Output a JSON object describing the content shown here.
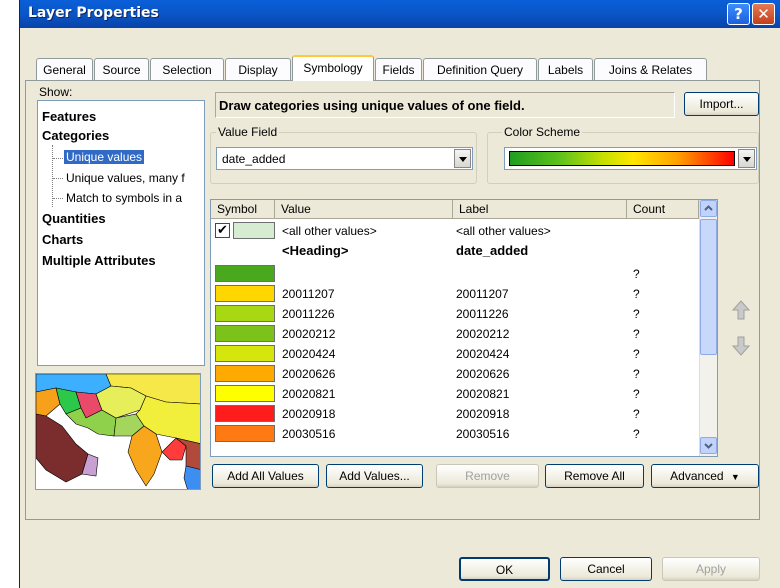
{
  "window": {
    "title": "Layer Properties",
    "help_button": "?",
    "close_button": "✕"
  },
  "tabs": [
    {
      "label": "General"
    },
    {
      "label": "Source"
    },
    {
      "label": "Selection"
    },
    {
      "label": "Display"
    },
    {
      "label": "Symbology",
      "active": true
    },
    {
      "label": "Fields"
    },
    {
      "label": "Definition Query"
    },
    {
      "label": "Labels"
    },
    {
      "label": "Joins & Relates"
    }
  ],
  "show": {
    "label": "Show:",
    "items": [
      {
        "label": "Features"
      },
      {
        "label": "Categories"
      },
      {
        "label": "Unique values",
        "selected": true
      },
      {
        "label": "Unique values, many f"
      },
      {
        "label": "Match to symbols in a"
      },
      {
        "label": "Quantities"
      },
      {
        "label": "Charts"
      },
      {
        "label": "Multiple Attributes"
      }
    ]
  },
  "description": "Draw categories using unique values of one field.",
  "import_button": "Import...",
  "value_field": {
    "label": "Value Field",
    "value": "date_added"
  },
  "color_scheme": {
    "label": "Color Scheme"
  },
  "table": {
    "headers": [
      "Symbol",
      "Value",
      "Label",
      "Count"
    ],
    "rows": [
      {
        "color": "#d6ecd1",
        "value": "<all other values>",
        "label": "<all other values>",
        "count": "",
        "checkbox": true
      },
      {
        "color": "",
        "value": "<Heading>",
        "label": "date_added",
        "count": "",
        "heading": true
      },
      {
        "color": "#4aa81e",
        "value": "",
        "label": "",
        "count": "?"
      },
      {
        "color": "#ffd700",
        "value": "20011207",
        "label": "20011207",
        "count": "?"
      },
      {
        "color": "#a8d811",
        "value": "20011226",
        "label": "20011226",
        "count": "?"
      },
      {
        "color": "#7cc21a",
        "value": "20020212",
        "label": "20020212",
        "count": "?"
      },
      {
        "color": "#d4e60c",
        "value": "20020424",
        "label": "20020424",
        "count": "?"
      },
      {
        "color": "#ffaa00",
        "value": "20020626",
        "label": "20020626",
        "count": "?"
      },
      {
        "color": "#ffff00",
        "value": "20020821",
        "label": "20020821",
        "count": "?"
      },
      {
        "color": "#ff1c1c",
        "value": "20020918",
        "label": "20020918",
        "count": "?"
      },
      {
        "color": "#ff7a12",
        "value": "20030516",
        "label": "20030516",
        "count": "?"
      }
    ]
  },
  "buttons": {
    "add_all": "Add All Values",
    "add": "Add Values...",
    "remove": "Remove",
    "remove_all": "Remove All",
    "advanced": "Advanced",
    "ok": "OK",
    "cancel": "Cancel",
    "apply": "Apply"
  }
}
